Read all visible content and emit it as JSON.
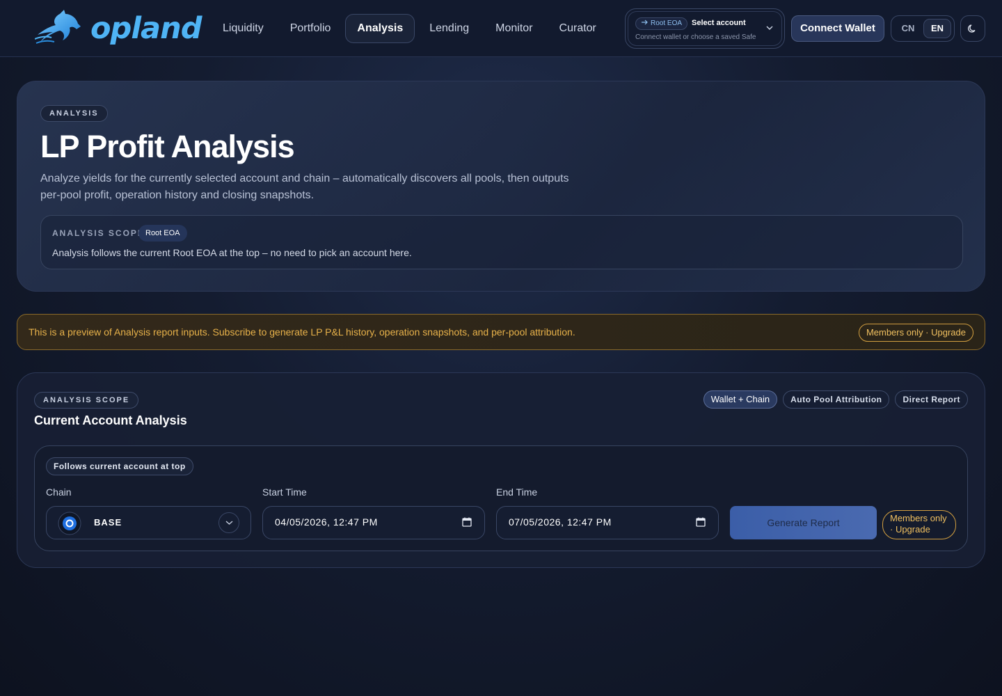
{
  "app": {
    "logo_text": "opland"
  },
  "nav": [
    {
      "label": "Liquidity",
      "active": false
    },
    {
      "label": "Portfolio",
      "active": false
    },
    {
      "label": "Analysis",
      "active": true
    },
    {
      "label": "Lending",
      "active": false
    },
    {
      "label": "Monitor",
      "active": false
    },
    {
      "label": "Curator",
      "active": false
    }
  ],
  "account": {
    "badge": "Root EOA",
    "title": "Select account",
    "subtitle": "Connect wallet or choose a saved Safe"
  },
  "header": {
    "connect_label": "Connect Wallet",
    "languages": [
      "CN",
      "EN"
    ],
    "active_language": "EN"
  },
  "hero": {
    "eyebrow": "ANALYSIS",
    "title": "LP Profit Analysis",
    "description": "Analyze yields for the currently selected account and chain – automatically discovers all pools, then outputs per-pool profit, operation history and closing snapshots.",
    "scope_label": "ANALYSIS SCOPE",
    "scope_badge": "Root EOA",
    "scope_text": "Analysis follows the current Root EOA at the top – no need to pick an account here."
  },
  "notice": {
    "text": "This is a preview of Analysis report inputs. Subscribe to generate LP P&L history, operation snapshots, and per-pool attribution.",
    "button": "Members only · Upgrade"
  },
  "panel": {
    "eyebrow": "ANALYSIS SCOPE",
    "title": "Current Account Analysis",
    "tags": [
      {
        "label": "Wallet + Chain",
        "active": true
      },
      {
        "label": "Auto Pool Attribution",
        "active": false
      },
      {
        "label": "Direct Report",
        "active": false
      }
    ],
    "follow_label": "Follows current account at top",
    "chain_label": "Chain",
    "chain_value": "BASE",
    "start_label": "Start Time",
    "start_value": "04/05/2026, 12:47 PM",
    "end_label": "End Time",
    "end_value": "07/05/2026, 12:47 PM",
    "generate_label": "Generate Report",
    "members_label": "Members only · Upgrade"
  },
  "colors": {
    "accent": "#4fb4f5",
    "warning": "#e8b24a",
    "primary_button": "#3b5ea8"
  }
}
